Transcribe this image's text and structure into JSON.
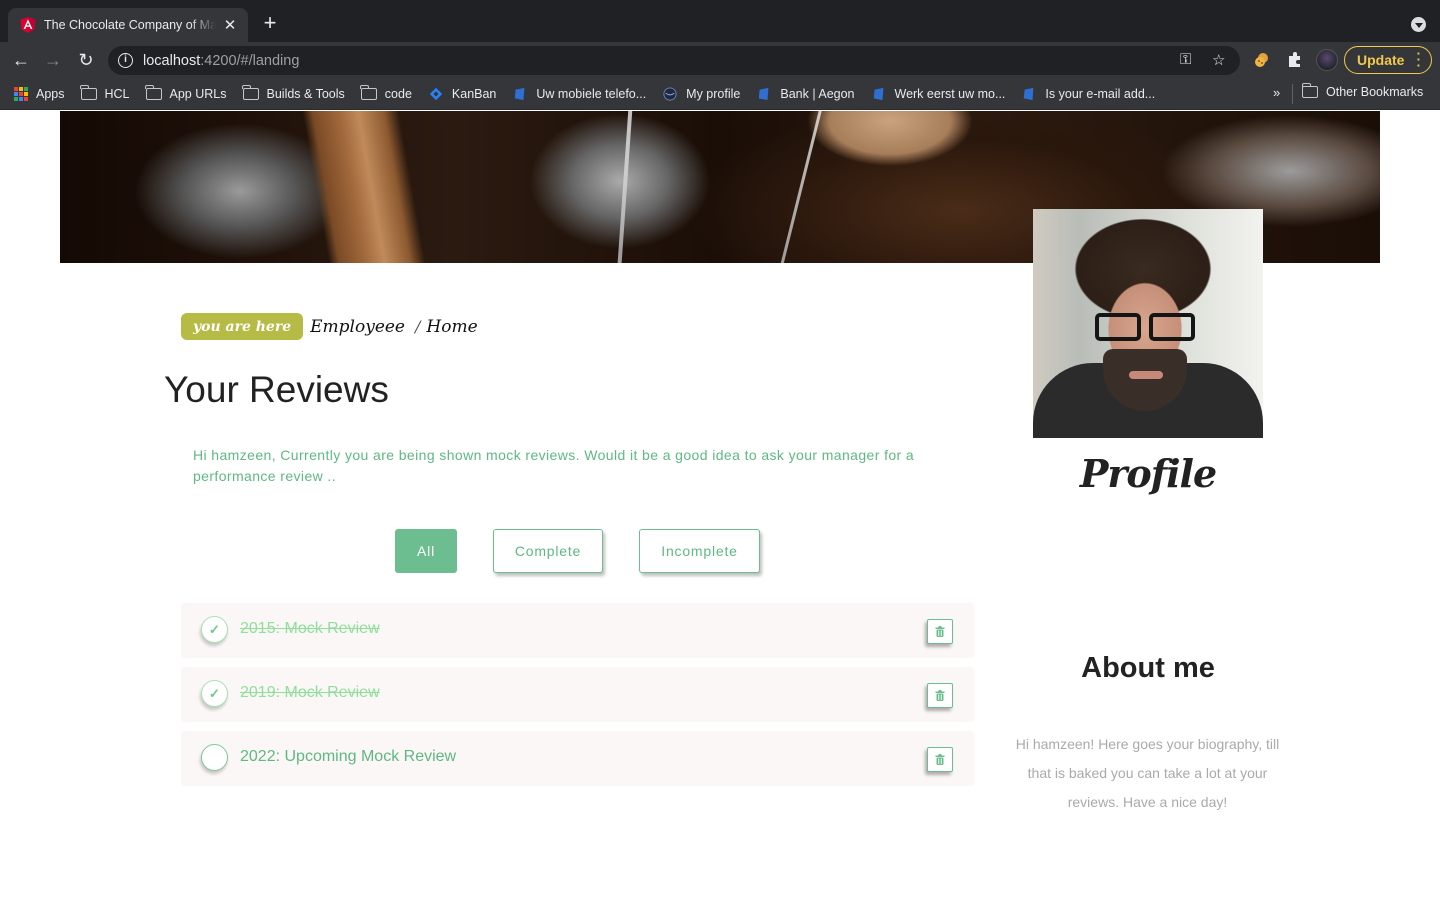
{
  "browser": {
    "tab_title": "The Chocolate Company of Ma",
    "url_host": "localhost",
    "url_rest": ":4200/#/landing",
    "update_label": "Update",
    "bookmarks": [
      {
        "label": "Apps",
        "icon": "apps-grid-icon"
      },
      {
        "label": "HCL",
        "icon": "folder-icon"
      },
      {
        "label": "App URLs",
        "icon": "folder-icon"
      },
      {
        "label": "Builds & Tools",
        "icon": "folder-icon"
      },
      {
        "label": "code",
        "icon": "folder-icon"
      },
      {
        "label": "KanBan",
        "icon": "diamond-icon"
      },
      {
        "label": "Uw mobiele telefo...",
        "icon": "bookmark-site-icon"
      },
      {
        "label": "My profile",
        "icon": "globe-icon"
      },
      {
        "label": "Bank | Aegon",
        "icon": "bookmark-site-icon"
      },
      {
        "label": "Werk eerst uw mo...",
        "icon": "bookmark-site-icon"
      },
      {
        "label": "Is your e-mail add...",
        "icon": "bookmark-site-icon"
      }
    ],
    "more_bookmarks": "»",
    "other_bookmarks": "Other Bookmarks"
  },
  "breadcrumb": {
    "badge": "you are here",
    "items": [
      "Employeee",
      "Home"
    ],
    "separator": "/"
  },
  "main": {
    "title": "Your Reviews",
    "intro": "Hi hamzeen, Currently you are being shown mock reviews. Would it be a good idea to ask your manager for a performance review ..",
    "filters": [
      {
        "label": "All",
        "active": true
      },
      {
        "label": "Complete",
        "active": false
      },
      {
        "label": "Incomplete",
        "active": false
      }
    ],
    "reviews": [
      {
        "title": "2015: Mock Review",
        "complete": true
      },
      {
        "title": "2019: Mock Review",
        "complete": true
      },
      {
        "title": "2022: Upcoming Mock Review",
        "complete": false
      }
    ]
  },
  "sidebar": {
    "profile_label": "Profile",
    "about_title": "About me",
    "about_text": "Hi hamzeen! Here goes your biography, till that is baked you can take a lot at your reviews. Have a nice day!"
  },
  "colors": {
    "accent_green": "#6cbd8f",
    "badge_olive": "#b5bb45",
    "update_yellow": "#f2c94c"
  }
}
